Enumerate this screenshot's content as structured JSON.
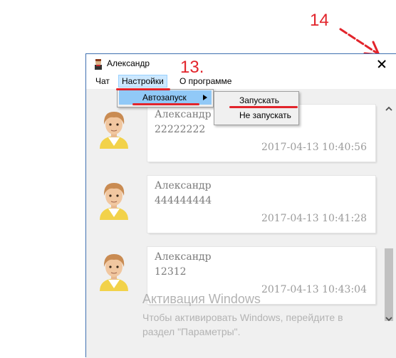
{
  "window": {
    "title": "Александр",
    "menu": {
      "chat": "Чат",
      "settings": "Настройки",
      "about": "О программе"
    }
  },
  "submenu": {
    "autostart": "Автозапуск",
    "options": [
      "Запускать",
      "Не запускать"
    ]
  },
  "messages": [
    {
      "name": "Александр",
      "text": "22222222",
      "time": "2017-04-13 10:40:56"
    },
    {
      "name": "Александр",
      "text": "444444444",
      "time": "2017-04-13 10:41:28"
    },
    {
      "name": "Александр",
      "text": "12312",
      "time": "2017-04-13 10:43:04"
    }
  ],
  "watermark": {
    "title": "Активация Windows",
    "line1": "Чтобы активировать Windows, перейдите в",
    "line2": "раздел \"Параметры\"."
  },
  "annotations": {
    "step_13": "13.",
    "step_14": "14"
  },
  "colors": {
    "annotation_red": "#e2242b",
    "menu_highlight": "#91c9f7"
  }
}
